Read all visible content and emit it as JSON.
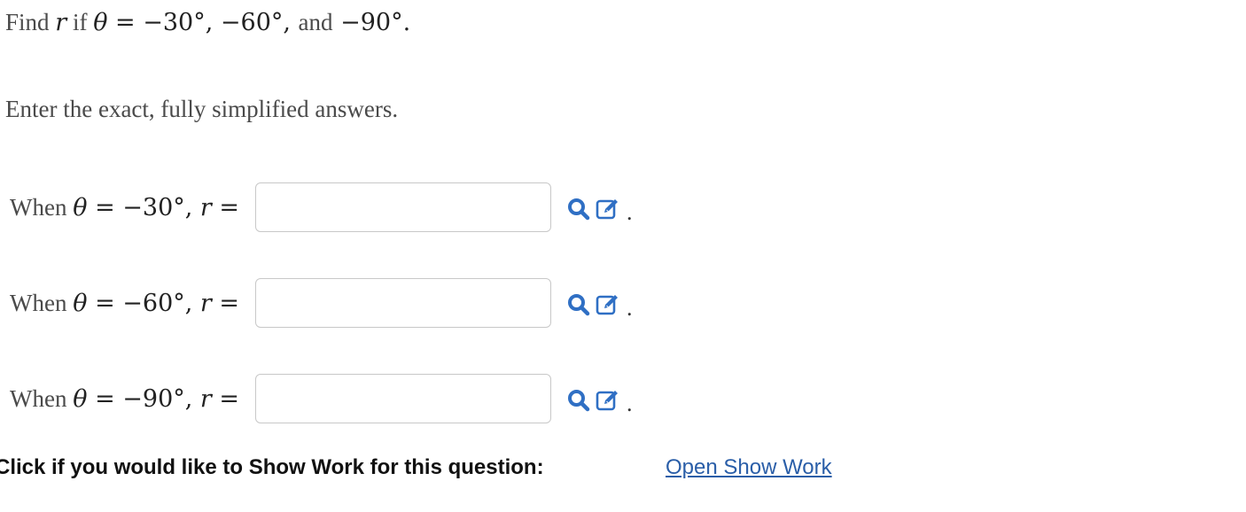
{
  "question": {
    "prompt_prefix": "Find ",
    "prompt_var": "r",
    "prompt_if": " if ",
    "prompt_theta": "θ",
    "prompt_values": " = −30°, −60°, ",
    "prompt_and": "and",
    "prompt_last": " −90°.",
    "instructions": "Enter the exact, fully simplified answers."
  },
  "answers": [
    {
      "when": "When ",
      "theta": "θ",
      "eq": " = −30°, ",
      "r": "r",
      "req": " =",
      "value": ""
    },
    {
      "when": "When ",
      "theta": "θ",
      "eq": " = −60°, ",
      "r": "r",
      "req": " =",
      "value": ""
    },
    {
      "when": "When ",
      "theta": "θ",
      "eq": " = −90°, ",
      "r": "r",
      "req": " =",
      "value": ""
    }
  ],
  "period": ".",
  "icons": {
    "preview": "magnifier-icon",
    "edit": "edit-pencil-icon",
    "accent": "#2f6fc4"
  },
  "show_work": {
    "label": "Click if you would like to Show Work for this question:",
    "link": "Open Show Work",
    "link_color": "#2a5ea8"
  }
}
